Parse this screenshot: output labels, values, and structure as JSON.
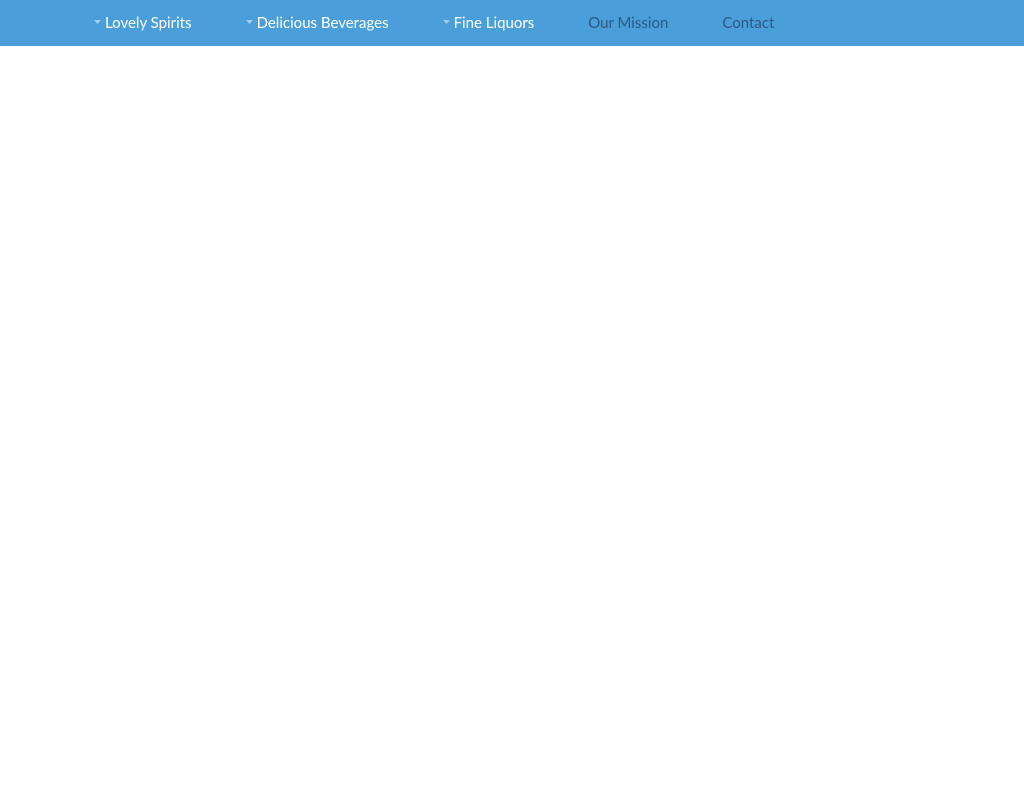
{
  "nav": {
    "items": [
      {
        "label": "Lovely Spirits",
        "hasDropdown": true
      },
      {
        "label": "Delicious Beverages",
        "hasDropdown": true
      },
      {
        "label": "Fine Liquors",
        "hasDropdown": true
      },
      {
        "label": "Our Mission",
        "hasDropdown": false
      },
      {
        "label": "Contact",
        "hasDropdown": false
      }
    ]
  },
  "colors": {
    "navBackground": "#4a9ed9",
    "navTextDropdown": "#ffffff",
    "navTextPlain": "#2a5a85"
  }
}
